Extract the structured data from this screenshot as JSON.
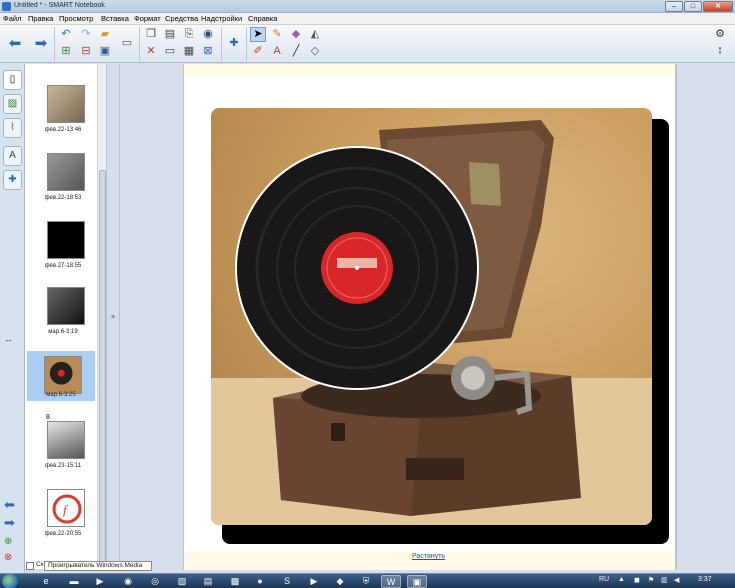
{
  "window": {
    "title": "Untitled * - SMART Notebook",
    "min": "–",
    "max": "□",
    "close": "✕"
  },
  "menu": [
    "Файл",
    "Правка",
    "Просмотр",
    "Вставка",
    "Формат",
    "Средства",
    "Надстройки",
    "Справка"
  ],
  "toolbar": {
    "icons": [
      "back-arrow-icon",
      "forward-arrow-icon",
      "undo-icon",
      "redo-icon",
      "open-folder-icon",
      "paste-icon",
      "insert-picture-icon",
      "screen-shade-icon",
      "save-icon",
      "delete-icon",
      "table-icon",
      "screen-capture-icon",
      "full-screen-icon",
      "camera-icon",
      "show-screen-icon",
      "add-ons-icon",
      "select-arrow-icon",
      "magic-pen-icon",
      "eraser-icon",
      "fill-icon",
      "pens-icon",
      "text-icon",
      "line-icon",
      "shapes-icon"
    ],
    "settings_icon": "gear-icon",
    "move_icon": "move-toolbar-icon"
  },
  "sidebar_tabs": [
    "page-sorter-icon",
    "gallery-icon",
    "attachments-icon",
    "properties-icon",
    "add-ons-tab-icon"
  ],
  "slides": [
    {
      "caption": "фев.22-13:46",
      "num": ""
    },
    {
      "caption": "фев.22-18:53",
      "num": ""
    },
    {
      "caption": "фев.27-18:55",
      "num": ""
    },
    {
      "caption": "мар.6-3:19",
      "num": ""
    },
    {
      "caption": "мар.6-3:25",
      "num": ""
    },
    {
      "caption": "фев.23-15:11",
      "num": "8"
    },
    {
      "caption": "фев.22-20:55",
      "num": ""
    }
  ],
  "canvas": {
    "expand_link": "Растянуть"
  },
  "tooltip": {
    "text": "Проигрыватель Windows Media",
    "checkbox_label": "Ск"
  },
  "taskbar": {
    "lang": "RU",
    "clock": "3:37"
  },
  "colors": {
    "accent": "#2a6bbf",
    "record_label": "#d8262a",
    "background_photo": "#c99c5e"
  }
}
